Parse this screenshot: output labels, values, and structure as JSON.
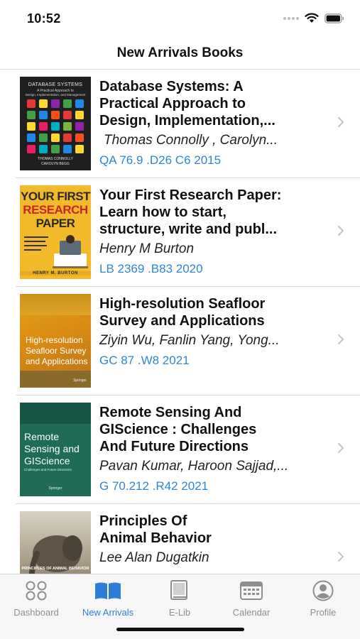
{
  "status": {
    "time": "10:52"
  },
  "nav": {
    "title": "New Arrivals Books"
  },
  "books": [
    {
      "title_lines": [
        "Database Systems: A",
        "Practical Approach to",
        "Design, Implementation,..."
      ],
      "author": "Thomas Connolly , Carolyn...",
      "call_number": "QA 76.9 .D26 C6 2015",
      "cover": {
        "lines": [
          "DATABASE SYSTEMS",
          "A Practical Approach to",
          "Design, Implementation, and Management",
          "THOMAS CONNOLLY",
          "CAROLYN BEGG"
        ]
      }
    },
    {
      "title_lines": [
        "Your First Research Paper:",
        "Learn how to start,",
        "structure, write and publ..."
      ],
      "author": "Henry M Burton",
      "call_number": "LB 2369 .B83 2020",
      "cover": {
        "lines": [
          "YOUR FIRST",
          "RESEARCH",
          "PAPER",
          "HENRY M. BURTON"
        ]
      }
    },
    {
      "title_lines": [
        "High-resolution Seafloor",
        "Survey and Applications"
      ],
      "author": "Ziyin Wu, Fanlin Yang, Yong...",
      "call_number": "GC 87 .W8 2021",
      "cover": {
        "lines": [
          "High-resolution",
          "Seafloor Survey",
          "and Applications",
          "Springer"
        ]
      }
    },
    {
      "title_lines": [
        "Remote Sensing And",
        "GIScience : Challenges",
        "And Future Directions"
      ],
      "author": "Pavan Kumar, Haroon Sajjad,...",
      "call_number": "G 70.212 .R42 2021",
      "cover": {
        "lines": [
          "Remote",
          "Sensing and",
          "GIScience",
          "Challenges and Future Directions",
          "Springer"
        ]
      }
    },
    {
      "title_lines": [
        "Principles Of",
        "Animal Behavior"
      ],
      "author": "Lee Alan Dugatkin",
      "call_number": "",
      "cover": {
        "lines": [
          "PRINCIPLES OF ANIMAL BEHAVIOR"
        ]
      }
    }
  ],
  "tabs": [
    {
      "label": "Dashboard",
      "icon": "dashboard-icon",
      "active": false
    },
    {
      "label": "New Arrivals",
      "icon": "book-open-icon",
      "active": true
    },
    {
      "label": "E-Lib",
      "icon": "ebook-icon",
      "active": false
    },
    {
      "label": "Calendar",
      "icon": "calendar-icon",
      "active": false
    },
    {
      "label": "Profile",
      "icon": "profile-icon",
      "active": false
    }
  ],
  "colors": {
    "accent": "#2d7fd6",
    "call_number": "#2f86d8",
    "inactive_tab": "#8e8e8e"
  }
}
